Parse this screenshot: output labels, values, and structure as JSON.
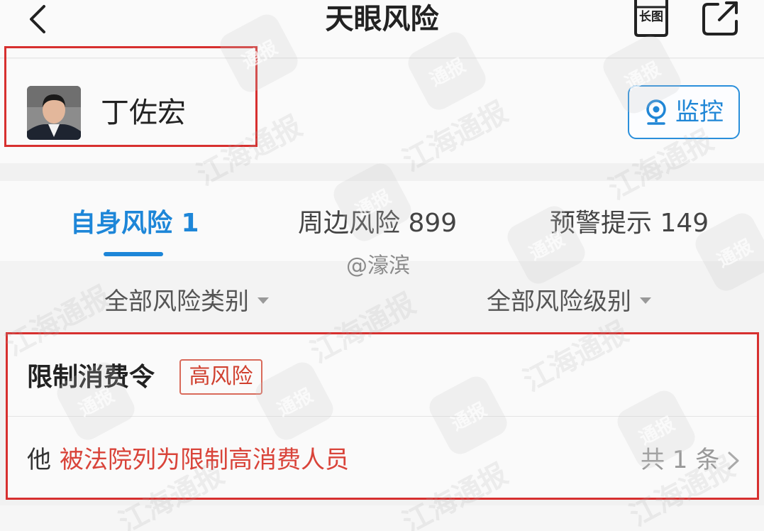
{
  "header": {
    "title": "天眼风险",
    "long_image_label": "长图"
  },
  "person": {
    "name": "丁佐宏",
    "monitor_label": "监控"
  },
  "tabs": [
    {
      "label": "自身风险 1",
      "active": true
    },
    {
      "label": "周边风险 899",
      "active": false
    },
    {
      "label": "预警提示 149",
      "active": false
    }
  ],
  "filters": {
    "category": "全部风险类别",
    "level": "全部风险级别"
  },
  "risk": {
    "title": "限制消费令",
    "badge": "高风险",
    "subject": "他",
    "description": "被法院列为限制高消费人员",
    "count": "共 1 条"
  },
  "watermark": {
    "handle": "@濠滨",
    "text": "江海通报",
    "badge_text": "通报"
  },
  "colors": {
    "accent": "#1d86d8",
    "danger": "#d9443a",
    "highlight": "#d7302f"
  },
  "icons": {
    "back": "chevron-left-icon",
    "long_image": "long-image-icon",
    "share": "share-icon",
    "monitor": "webcam-icon",
    "dropdown": "caret-down-icon",
    "row_more": "chevron-right-icon"
  }
}
